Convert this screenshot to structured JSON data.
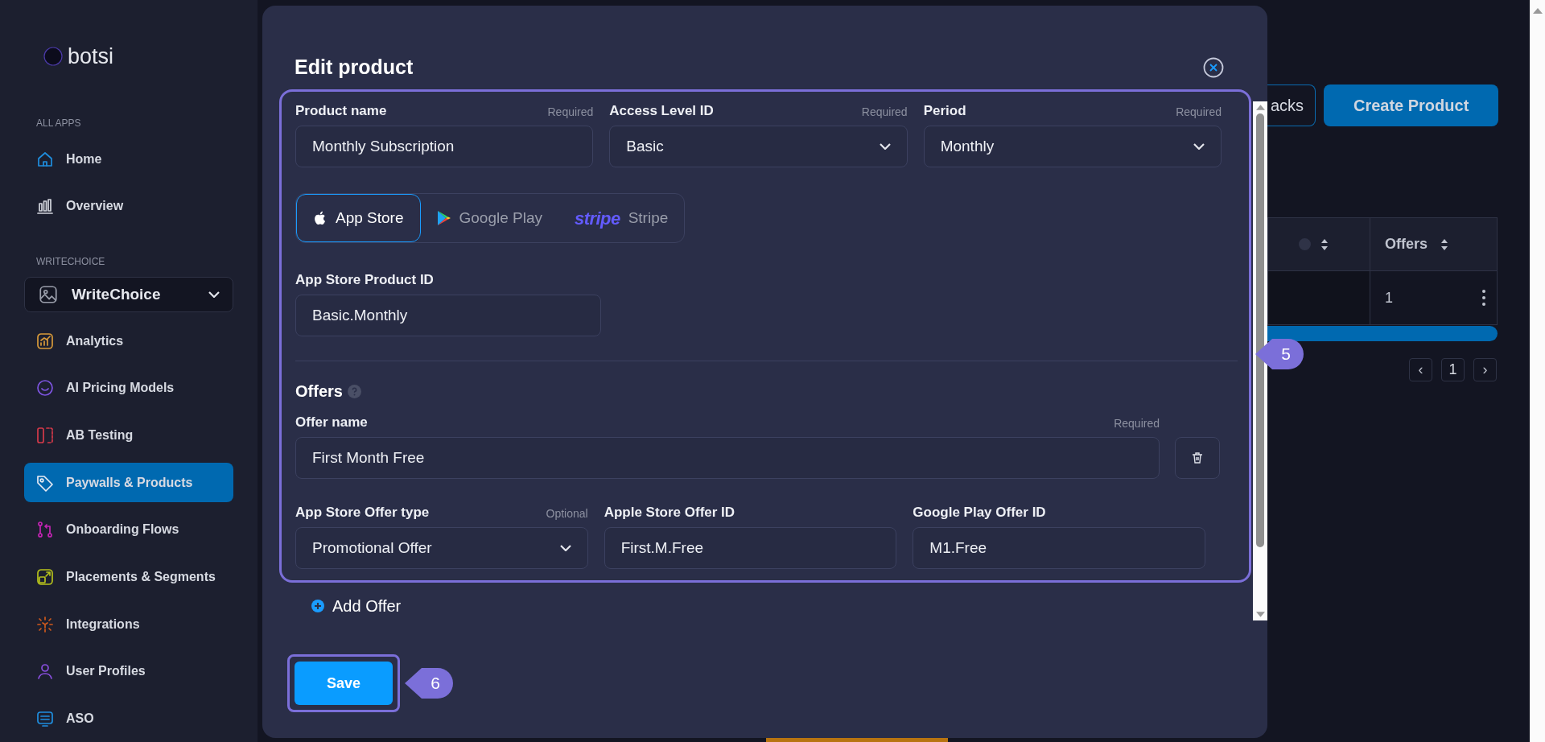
{
  "sidebar": {
    "logo": "botsi",
    "sections": [
      {
        "heading": "ALL APPS",
        "items": [
          {
            "label": "Home",
            "selected": false
          },
          {
            "label": "Overview",
            "selected": false
          }
        ]
      },
      {
        "heading": "WRITECHOICE",
        "app_selector": "WriteChoice",
        "items": [
          {
            "label": "Analytics",
            "selected": false
          },
          {
            "label": "AI Pricing Models",
            "selected": false
          },
          {
            "label": "AB Testing",
            "selected": false
          },
          {
            "label": "Paywalls & Products",
            "selected": true
          },
          {
            "label": "Onboarding Flows",
            "selected": false
          },
          {
            "label": "Placements & Segments",
            "selected": false
          },
          {
            "label": "Integrations",
            "selected": false
          },
          {
            "label": "User Profiles",
            "selected": false
          },
          {
            "label": "ASO",
            "selected": false
          }
        ]
      }
    ]
  },
  "background": {
    "buttons": [
      {
        "label": "acks",
        "kind": "outline"
      },
      {
        "label": "Create Product",
        "kind": "primary"
      }
    ],
    "table": {
      "columns": [
        "Offers"
      ],
      "rows": [
        {
          "offers": "1"
        }
      ]
    },
    "pagination": {
      "prev": "‹",
      "page": "1",
      "next": "›"
    }
  },
  "modal": {
    "title": "Edit product",
    "fields": [
      {
        "label": "Product name",
        "note": "Required",
        "value": "Monthly Subscription",
        "kind": "text"
      },
      {
        "label": "Access Level ID",
        "note": "Required",
        "value": "Basic",
        "kind": "select"
      },
      {
        "label": "Period",
        "note": "Required",
        "value": "Monthly",
        "kind": "select"
      }
    ],
    "store_tabs": [
      {
        "label": "App Store",
        "selected": true
      },
      {
        "label": "Google Play",
        "selected": false
      },
      {
        "label": "Stripe",
        "logo_text": "stripe",
        "selected": false
      }
    ],
    "product_id": {
      "label": "App Store Product ID",
      "value": "Basic.Monthly"
    },
    "offers": {
      "title": "Offers",
      "items": [
        {
          "name": {
            "label": "Offer name",
            "note": "Required",
            "value": "First Month Free"
          },
          "fields": [
            {
              "label": "App Store Offer type",
              "note": "Optional",
              "value": "Promotional Offer",
              "kind": "select"
            },
            {
              "label": "Apple Store Offer ID",
              "value": "First.M.Free",
              "kind": "text"
            },
            {
              "label": "Google Play Offer ID",
              "value": "M1.Free",
              "kind": "text"
            }
          ]
        }
      ]
    },
    "add_offer": "Add Offer",
    "save": "Save"
  },
  "callouts": [
    "5",
    "6"
  ]
}
